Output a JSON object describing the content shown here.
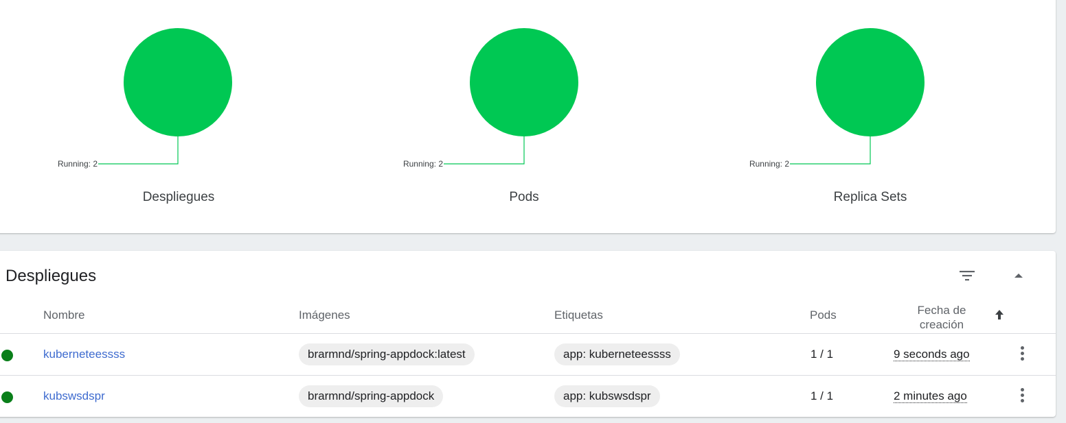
{
  "colors": {
    "running": "#00c853",
    "status_ok": "#0a7f1a",
    "link": "#3e6bcf"
  },
  "summary": {
    "charts": [
      {
        "title": "Despliegues",
        "legend": "Running: 2",
        "running": 2
      },
      {
        "title": "Pods",
        "legend": "Running: 2",
        "running": 2
      },
      {
        "title": "Replica Sets",
        "legend": "Running: 2",
        "running": 2
      }
    ]
  },
  "deployments": {
    "title": "Despliegues",
    "filter_icon": "filter-list-icon",
    "collapse_icon": "arrow-drop-up-icon",
    "columns": {
      "name": "Nombre",
      "images": "Imágenes",
      "labels": "Etiquetas",
      "pods": "Pods",
      "created_line1": "Fecha de",
      "created_line2": "creación",
      "sort_icon": "arrow-upward-icon"
    },
    "rows": [
      {
        "status": "running",
        "name": "kuberneteessss",
        "image": "brarmnd/spring-appdock:latest",
        "label": "app: kuberneteessss",
        "pods": "1 / 1",
        "created": "9 seconds ago"
      },
      {
        "status": "running",
        "name": "kubswsdspr",
        "image": "brarmnd/spring-appdock",
        "label": "app: kubswsdspr",
        "pods": "1 / 1",
        "created": "2 minutes ago"
      }
    ]
  }
}
